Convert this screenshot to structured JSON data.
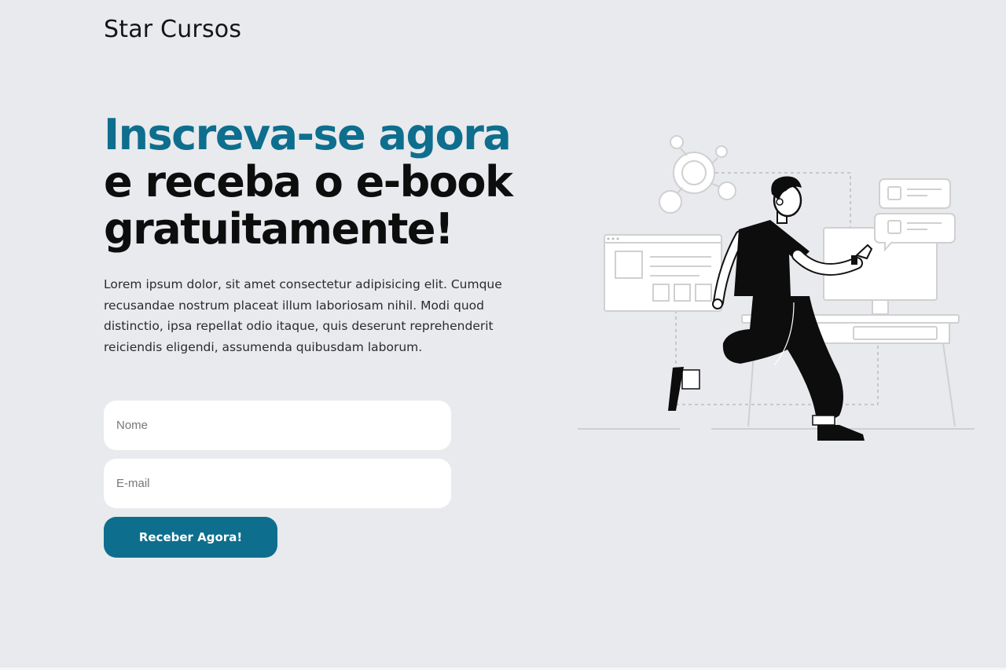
{
  "header": {
    "logo": "Star Cursos"
  },
  "hero": {
    "headline_accent": "Inscreva-se agora",
    "headline_line2": "e receba o e-book",
    "headline_line3": "gratuitamente!",
    "description": "Lorem ipsum dolor, sit amet consectetur adipisicing elit. Cumque recusandae nostrum placeat illum laboriosam nihil. Modi quod distinctio, ipsa repellat odio itaque, quis deserunt reprehenderit reiciendis eligendi, assumenda quibusdam laborum."
  },
  "form": {
    "name_placeholder": "Nome",
    "email_placeholder": "E-mail",
    "submit_label": "Receber Agora!"
  },
  "colors": {
    "accent": "#0e6e8e",
    "background": "#e8eaed",
    "field_background": "#ffffff"
  },
  "illustration": {
    "icon": "person-running-to-computer-illustration"
  }
}
